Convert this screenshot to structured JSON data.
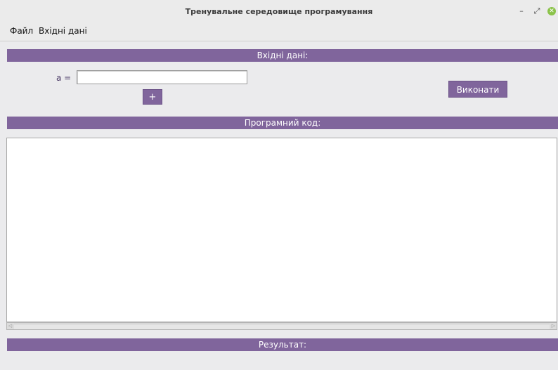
{
  "window": {
    "title": "Тренувальне середовище програмування",
    "controls": {
      "minimize": "–",
      "maximize": "⤢",
      "close": "✕"
    }
  },
  "menu": {
    "file": "Файл",
    "input_data": "Вхідні дані"
  },
  "input_section": {
    "header": "Вхідні дані:",
    "variable_label": "a =",
    "variable_value": "",
    "add_button": "+",
    "run_button": "Виконати"
  },
  "code_section": {
    "header": "Програмний код:",
    "code": ""
  },
  "result_section": {
    "header": "Результат:",
    "output": ""
  },
  "colors": {
    "accent": "#80659c",
    "background": "#ebebed"
  }
}
